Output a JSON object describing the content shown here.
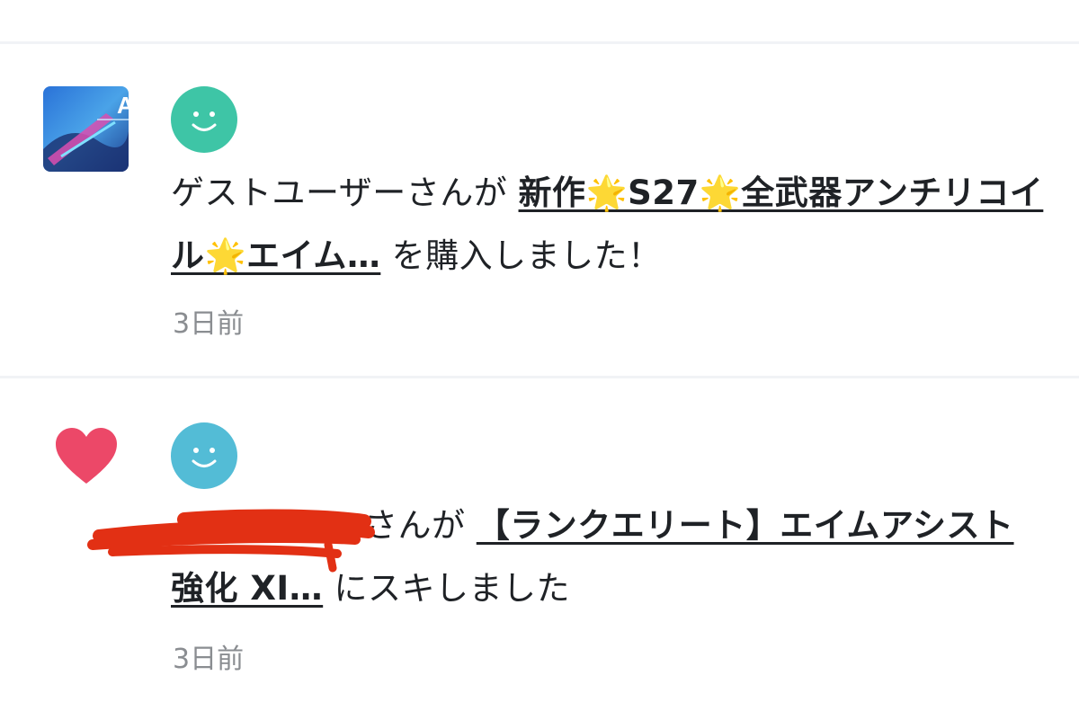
{
  "notifications": [
    {
      "user": "ゲストユーザー",
      "user_suffix": "さんが",
      "product": "新作🌟S27🌟全武器アンチリコイル🌟エイム…",
      "action": "を購入しました！",
      "time": "3日前",
      "avatar_color": "#3ec5a6",
      "thumbnail_text": "AP"
    },
    {
      "user": "",
      "user_suffix": "さんが",
      "product": "【ランクエリート】エイムアシスト強化 XI…",
      "action": "にスキしました",
      "time": "3日前",
      "avatar_color": "#53bcd6",
      "icon": "heart-icon",
      "icon_color": "#ec4868"
    }
  ],
  "colors": {
    "divider": "#f1f3f6",
    "text": "#1f2226",
    "muted": "#8a8d91",
    "redaction": "#e23014"
  }
}
